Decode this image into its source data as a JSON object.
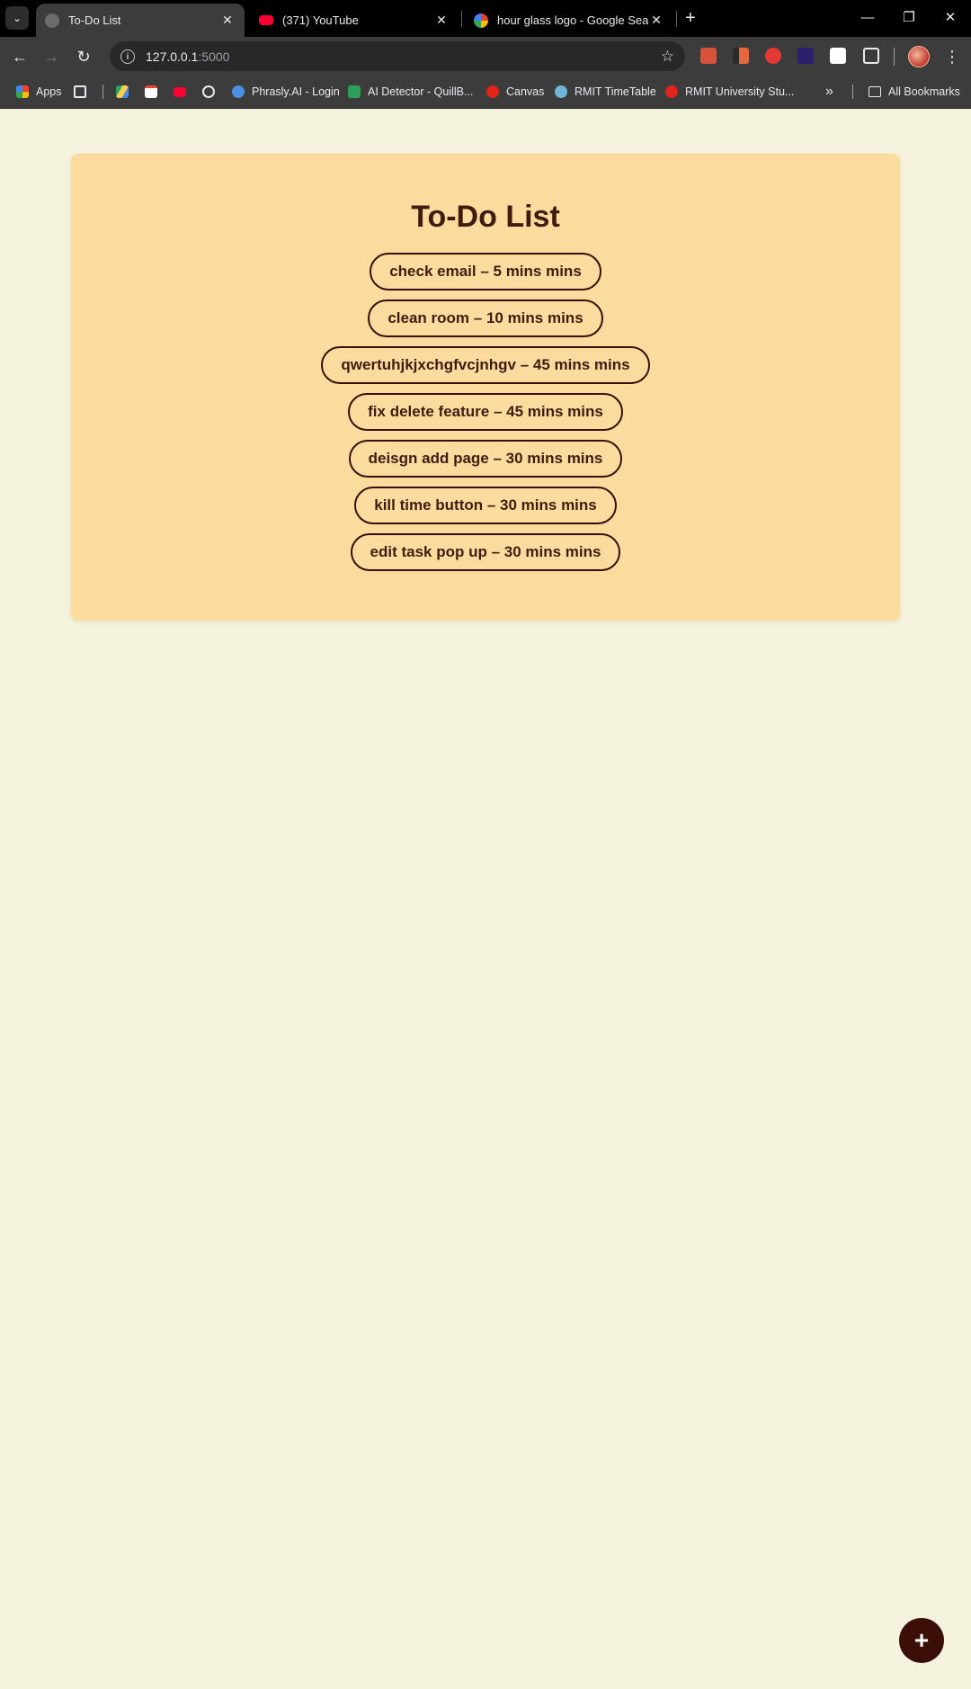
{
  "browser": {
    "tabs": [
      {
        "title": "To-Do List",
        "active": true,
        "favicon": "globe-icon"
      },
      {
        "title": "(371) YouTube",
        "active": false,
        "favicon": "youtube-icon"
      },
      {
        "title": "hour glass logo - Google Search",
        "active": false,
        "favicon": "google-icon"
      }
    ],
    "address": {
      "host": "127.0.0.1",
      "port": ":5000"
    },
    "bookmarks": [
      {
        "label": "Apps",
        "icon": "apps-grid-icon"
      },
      {
        "label": "",
        "icon": "tab-groups-icon"
      },
      {
        "label": "",
        "icon": "google-drive-icon"
      },
      {
        "label": "",
        "icon": "gmail-icon"
      },
      {
        "label": "",
        "icon": "youtube-icon"
      },
      {
        "label": "",
        "icon": "openai-icon"
      },
      {
        "label": "Phrasly.AI - Login",
        "icon": "phrasly-icon"
      },
      {
        "label": "AI Detector - QuillB...",
        "icon": "quillbot-icon"
      },
      {
        "label": "Canvas",
        "icon": "canvas-icon"
      },
      {
        "label": "RMIT TimeTable",
        "icon": "rmit-timetable-icon"
      },
      {
        "label": "RMIT University Stu...",
        "icon": "rmit-icon"
      }
    ],
    "all_bookmarks_label": "All Bookmarks"
  },
  "page": {
    "title": "To-Do List",
    "tasks": [
      "check email – 5 mins mins",
      "clean room – 10 mins mins",
      "qwertuhjkjxchgfvcjnhgv – 45 mins mins",
      "fix delete feature – 45 mins mins",
      "deisgn add page – 30 mins mins",
      "kill time button – 30 mins mins",
      "edit task pop up – 30 mins mins"
    ],
    "add_button_label": "+"
  },
  "colors": {
    "page_bg": "#f5f3dd",
    "card_bg": "#fcdb9f",
    "text_dark": "#431a10",
    "fab_bg": "#3b0f08"
  }
}
